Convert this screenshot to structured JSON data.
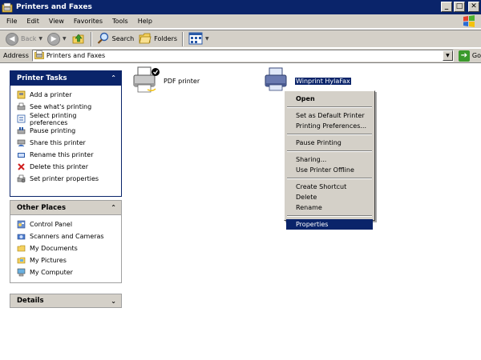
{
  "window": {
    "title": "Printers and Faxes",
    "title_icon": "printer-folder-icon",
    "buttons": {
      "minimize": "_",
      "maximize": "□",
      "close": "✕"
    }
  },
  "menubar": {
    "items": [
      "File",
      "Edit",
      "View",
      "Favorites",
      "Tools",
      "Help"
    ]
  },
  "toolbar": {
    "back_label": "Back",
    "search_label": "Search",
    "folders_label": "Folders"
  },
  "address": {
    "label": "Address",
    "value": "Printers and Faxes",
    "go_label": "Go"
  },
  "printer_tasks": {
    "title": "Printer Tasks",
    "items": [
      {
        "label": "Add a printer",
        "icon": "add-printer-icon"
      },
      {
        "label": "See what's printing",
        "icon": "print-queue-icon"
      },
      {
        "label": "Select printing preferences",
        "icon": "preferences-icon"
      },
      {
        "label": "Pause printing",
        "icon": "pause-icon"
      },
      {
        "label": "Share this printer",
        "icon": "share-icon"
      },
      {
        "label": "Rename this printer",
        "icon": "rename-icon"
      },
      {
        "label": "Delete this printer",
        "icon": "delete-icon"
      },
      {
        "label": "Set printer properties",
        "icon": "properties-icon"
      }
    ]
  },
  "other_places": {
    "title": "Other Places",
    "items": [
      {
        "label": "Control Panel",
        "icon": "control-panel-icon"
      },
      {
        "label": "Scanners and Cameras",
        "icon": "scanner-icon"
      },
      {
        "label": "My Documents",
        "icon": "folder-icon"
      },
      {
        "label": "My Pictures",
        "icon": "folder-icon"
      },
      {
        "label": "My Computer",
        "icon": "computer-icon"
      }
    ]
  },
  "details": {
    "title": "Details"
  },
  "printers": [
    {
      "name": "PDF printer",
      "default": true,
      "selected": false
    },
    {
      "name": "Winprint HylaFax",
      "default": false,
      "selected": true
    }
  ],
  "context_menu": {
    "groups": [
      [
        "Open"
      ],
      [
        "Set as Default Printer",
        "Printing Preferences..."
      ],
      [
        "Pause Printing"
      ],
      [
        "Sharing...",
        "Use Printer Offline"
      ],
      [
        "Create Shortcut",
        "Delete",
        "Rename"
      ],
      [
        "Properties"
      ]
    ],
    "highlighted": "Properties"
  },
  "colors": {
    "titlebar": "#0a246a",
    "selection": "#0a246a",
    "chrome": "#d4d0c8"
  }
}
